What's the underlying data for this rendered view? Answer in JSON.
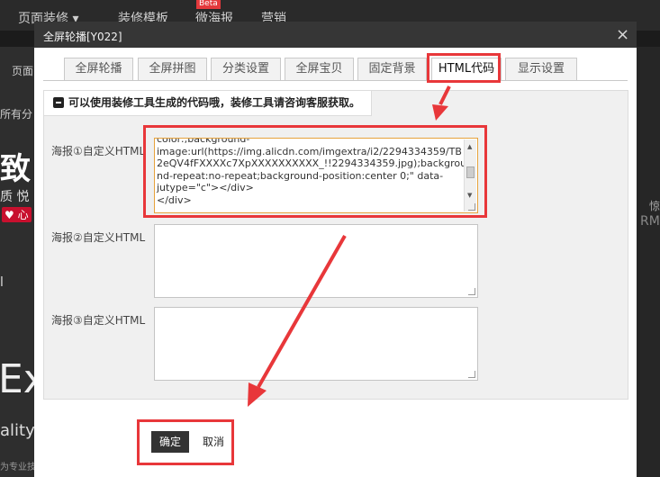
{
  "topbar": {
    "items": [
      "页面装修 ▾",
      "装修模板",
      "微海报",
      "营销"
    ],
    "beta_badge": "Beta"
  },
  "background": {
    "left_texts": [
      "页面",
      "所有分",
      "致",
      "质 悦",
      "♥ 心",
      "l",
      "Exc",
      "ality",
      "为专业技"
    ],
    "right_texts": [
      "惊",
      "RM"
    ]
  },
  "dialog": {
    "title": "全屏轮播[Y022]",
    "close_icon": "×",
    "tabs": [
      "全屏轮播",
      "全屏拼图",
      "分类设置",
      "全屏宝贝",
      "固定背景",
      "HTML代码",
      "显示设置"
    ],
    "active_tab": "HTML代码",
    "notice": "可以使用装修工具生成的代码哦，装修工具请咨询客服获取。",
    "fields": [
      {
        "label": "海报①自定义HTML",
        "value_lines": [
          "color:;background-",
          "image:url(https://img.alicdn.com/imgextra/i2/2294334359/TB",
          "2eQV4fFXXXXc7XpXXXXXXXXXX_!!2294334359.jpg);backgrou",
          "nd-repeat:no-repeat;background-position:center 0;\" data-",
          "jutype=\"c\"></div>",
          "</div>"
        ]
      },
      {
        "label": "海报②自定义HTML",
        "value_lines": []
      },
      {
        "label": "海报③自定义HTML",
        "value_lines": []
      }
    ],
    "buttons": {
      "ok": "确定",
      "cancel": "取消"
    }
  },
  "colors": {
    "annotation_red": "#e8373a",
    "header_bg": "#363636",
    "panel_bg": "#f0f0f0"
  }
}
